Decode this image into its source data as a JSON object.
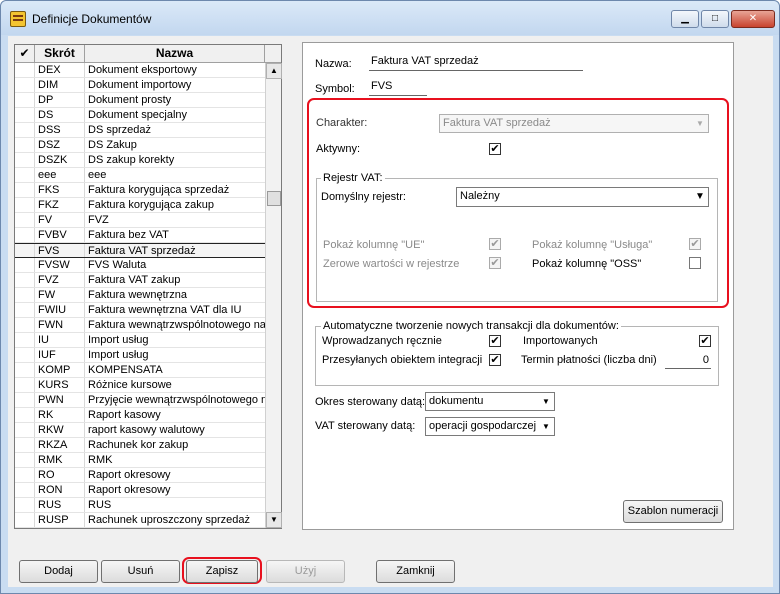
{
  "window": {
    "title": "Definicje Dokumentów",
    "min_glyph": "▁",
    "max_glyph": "□",
    "close_glyph": "✕"
  },
  "list": {
    "headers": {
      "check": "✔",
      "code": "Skrót",
      "name": "Nazwa"
    },
    "rows": [
      {
        "code": "DEX",
        "name": "Dokument eksportowy"
      },
      {
        "code": "DIM",
        "name": "Dokument importowy"
      },
      {
        "code": "DP",
        "name": "Dokument prosty"
      },
      {
        "code": "DS",
        "name": "Dokument specjalny"
      },
      {
        "code": "DSS",
        "name": "DS sprzedaż"
      },
      {
        "code": "DSZ",
        "name": "DS Zakup"
      },
      {
        "code": "DSZK",
        "name": "DS zakup korekty"
      },
      {
        "code": "eee",
        "name": "eee"
      },
      {
        "code": "FKS",
        "name": "Faktura korygująca sprzedaż"
      },
      {
        "code": "FKZ",
        "name": "Faktura korygująca zakup"
      },
      {
        "code": "FV",
        "name": "FVZ"
      },
      {
        "code": "FVBV",
        "name": "Faktura bez VAT"
      },
      {
        "code": "FVS",
        "name": "Faktura VAT sprzedaż",
        "selected": true
      },
      {
        "code": "FVSW",
        "name": "FVS Waluta"
      },
      {
        "code": "FVZ",
        "name": "Faktura VAT zakup"
      },
      {
        "code": "FW",
        "name": "Faktura wewnętrzna"
      },
      {
        "code": "FWIU",
        "name": "Faktura wewnętrzna VAT dla IU"
      },
      {
        "code": "FWN",
        "name": "Faktura wewnątrzwspólnotowego na"
      },
      {
        "code": "IU",
        "name": "Import usług"
      },
      {
        "code": "IUF",
        "name": "Import usług"
      },
      {
        "code": "KOMP",
        "name": "KOMPENSATA"
      },
      {
        "code": "KURS",
        "name": "Różnice kursowe"
      },
      {
        "code": "PWN",
        "name": "Przyjęcie wewnątrzwspólnotowego n"
      },
      {
        "code": "RK",
        "name": "Raport kasowy"
      },
      {
        "code": "RKW",
        "name": "raport kasowy walutowy"
      },
      {
        "code": "RKZA",
        "name": "Rachunek kor zakup"
      },
      {
        "code": "RMK",
        "name": "RMK"
      },
      {
        "code": "RO",
        "name": "Raport okresowy"
      },
      {
        "code": "RON",
        "name": "Raport okresowy"
      },
      {
        "code": "RUS",
        "name": "RUS"
      },
      {
        "code": "RUSP",
        "name": "Rachunek uproszczony sprzedaż"
      }
    ],
    "scroll_up": "▲",
    "scroll_down": "▼"
  },
  "form": {
    "nazwa_label": "Nazwa:",
    "nazwa_value": "Faktura VAT sprzedaż",
    "symbol_label": "Symbol:",
    "symbol_value": "FVS",
    "charakter_label": "Charakter:",
    "charakter_value": "Faktura VAT sprzedaż",
    "aktywny_label": "Aktywny:",
    "aktywny_checked": "✔",
    "rejestr": {
      "title": "Rejestr VAT:",
      "domyslny_label": "Domyślny rejestr:",
      "domyslny_value": "Należny",
      "pokaz_ue_label": "Pokaż kolumnę \"UE\"",
      "zerowe_label": "Zerowe wartości w rejestrze",
      "pokaz_usluga_label": "Pokaż kolumnę \"Usługa\"",
      "pokaz_oss_label": "Pokaż kolumnę \"OSS\"",
      "check_mark": "✔"
    },
    "auto": {
      "title": "Automatyczne tworzenie nowych transakcji dla dokumentów:",
      "wprowadzanych_label": "Wprowadzanych ręcznie",
      "przesylanych_label": "Przesyłanych obiektem integracji",
      "importowanych_label": "Importowanych",
      "termin_label": "Termin płatności (liczba dni)",
      "termin_value": "0",
      "check_mark": "✔"
    },
    "okres_label": "Okres sterowany datą:",
    "okres_value": "dokumentu",
    "vat_label": "VAT sterowany datą:",
    "vat_value": "operacji gospodarczej",
    "arrow": "▼",
    "szablon_button": "Szablon numeracji"
  },
  "buttons": {
    "dodaj": "Dodaj",
    "usun": "Usuń",
    "zapisz": "Zapisz",
    "uzyj": "Użyj",
    "zamknij": "Zamknij"
  }
}
